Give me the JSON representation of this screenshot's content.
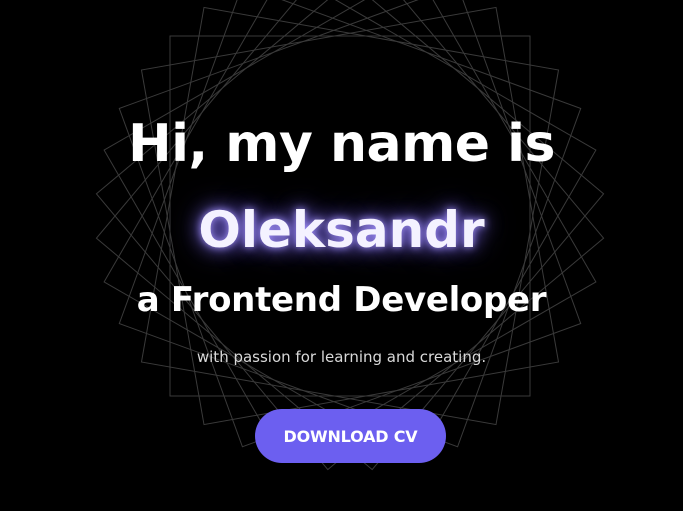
{
  "hero": {
    "greeting": "Hi, my name is",
    "name": "Oleksandr",
    "role": "a Frontend Developer",
    "tagline": "with passion for learning and creating.",
    "download_label": "DOWNLOAD CV"
  },
  "colors": {
    "background": "#000000",
    "text": "#ffffff",
    "accent": "#6c5ff0",
    "name_glow": "#a796ff",
    "decor_lines": "#3a3a3a"
  },
  "decor": {
    "icon": "rotated-squares-pattern"
  }
}
